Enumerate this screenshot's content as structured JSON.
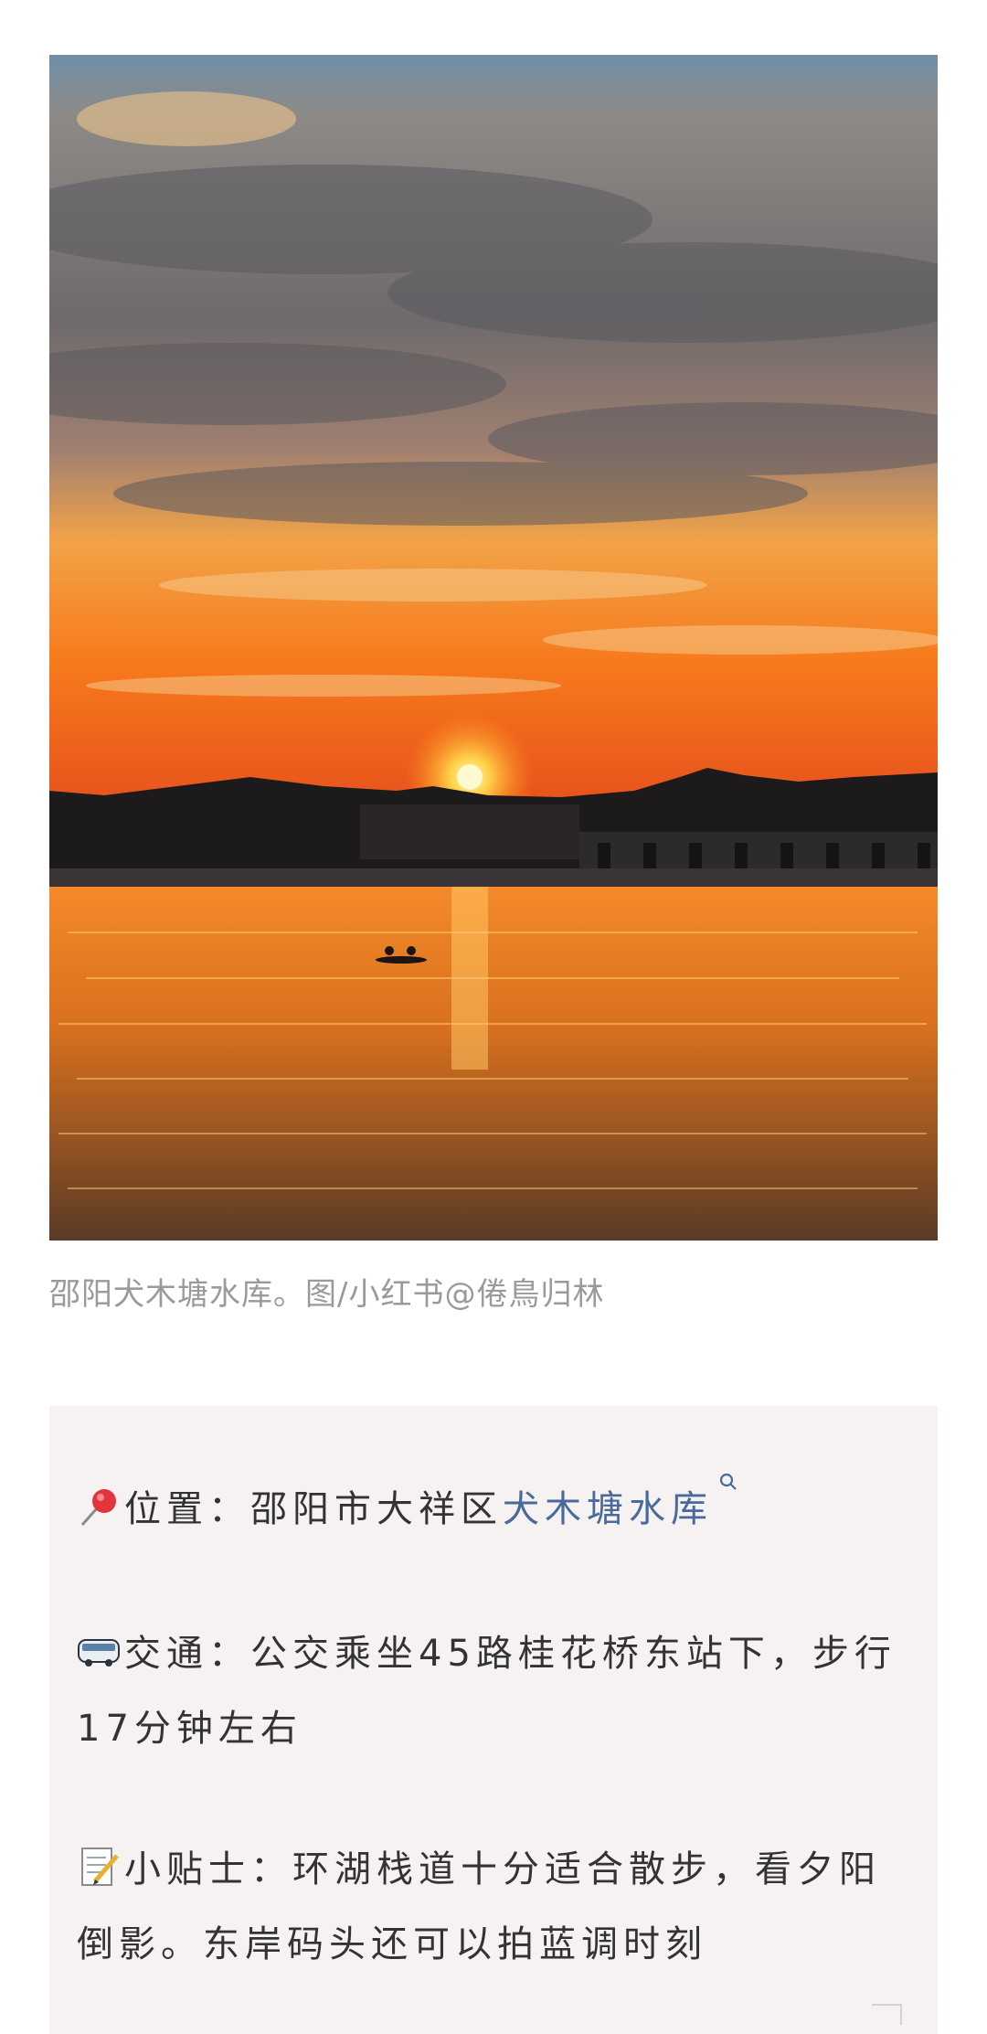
{
  "photo": {
    "alt_semantic": "sunset-over-reservoir-photo"
  },
  "caption": "邵阳犬木塘水库。图/小红书@倦鳥归林",
  "info": {
    "location": {
      "icon": "pushpin-icon",
      "label": "位置：",
      "text": "邵阳市大祥区",
      "link": "犬木塘水库"
    },
    "transport": {
      "icon": "bus-icon",
      "label": "交通：",
      "text": "公交乘坐45路桂花桥东站下，步行17分钟左右"
    },
    "tips": {
      "icon": "memo-icon",
      "label": "小贴士：",
      "text": "环湖栈道十分适合散步，看夕阳倒影。东岸码头还可以拍蓝调时刻"
    }
  },
  "colors": {
    "link": "#4a6a9c",
    "card_bg": "#f7f2f2",
    "caption": "#9a9a9a"
  }
}
